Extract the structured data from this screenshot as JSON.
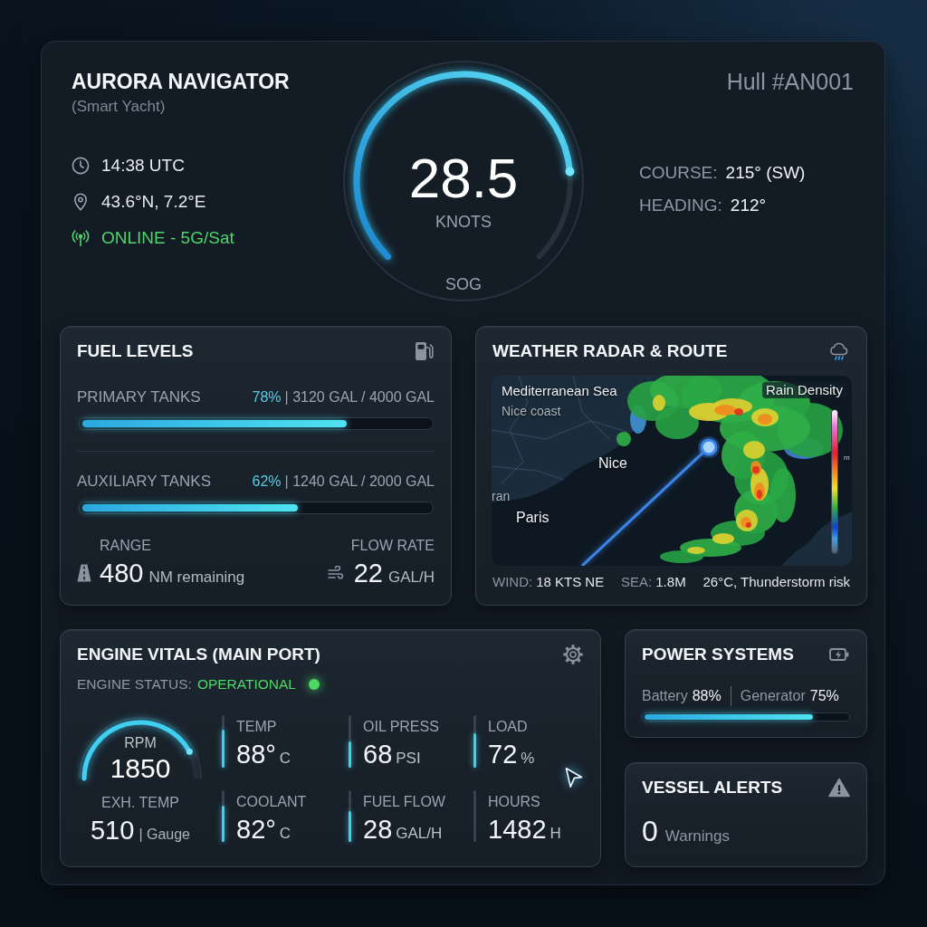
{
  "header": {
    "title": "AURORA NAVIGATOR",
    "subtitle": "(Smart Yacht)",
    "info": [
      {
        "kind": "time",
        "text": "14:38 UTC"
      },
      {
        "kind": "position",
        "text": "43.6°N, 7.2°E"
      },
      {
        "kind": "connection",
        "text": "ONLINE - 5G/Sat"
      }
    ],
    "speed_gauge": {
      "value": "28.5",
      "unit": "KNOTS",
      "caption": "SOG"
    },
    "hull": "Hull #AN001",
    "navigation": [
      {
        "label": "COURSE:",
        "value": "215° (SW)"
      },
      {
        "label": "HEADING:",
        "value": "212°"
      }
    ]
  },
  "fuel": {
    "title": "FUEL LEVELS",
    "tanks": [
      {
        "name": "PRIMARY TANKS",
        "percent": "78%",
        "detail": "| 3120 GAL / 4000 GAL",
        "level": 0.76
      },
      {
        "name": "AUXILIARY TANKS",
        "percent": "62%",
        "detail": "| 1240 GAL / 2000 GAL",
        "level": 0.62
      }
    ],
    "stats": [
      {
        "kind": "range",
        "label": "RANGE",
        "value": "480",
        "unit": "NM remaining"
      },
      {
        "kind": "flow",
        "label": "FLOW RATE",
        "value": "22",
        "unit": "GAL/H"
      }
    ]
  },
  "weather": {
    "title": "WEATHER RADAR & ROUTE",
    "map": {
      "region": "Mediterranean Sea",
      "area": "Nice coast",
      "places": [
        "Nice",
        "ran",
        "Paris"
      ],
      "legend_title": "Rain Density",
      "legend_unit": "m"
    },
    "conditions": [
      {
        "label": "WIND:",
        "value": "18 KTS NE"
      },
      {
        "label": "SEA:",
        "value": "1.8M"
      },
      {
        "value": "26°C, Thunderstorm risk"
      }
    ]
  },
  "engine": {
    "title": "ENGINE VITALS (MAIN PORT)",
    "status": {
      "label": "ENGINE STATUS:",
      "value": "OPERATIONAL",
      "ok": true
    },
    "rpm": {
      "label": "RPM",
      "value": "1850",
      "level": 0.84
    },
    "exhaust": {
      "label": "EXH. TEMP",
      "value": "510",
      "unit": "| Gauge"
    },
    "metrics": [
      {
        "label": "TEMP",
        "value": "88°",
        "unit": "C",
        "level": 0.72
      },
      {
        "label": "OIL PRESS",
        "value": "68",
        "unit": "PSI",
        "level": 0.5
      },
      {
        "label": "LOAD",
        "value": "72",
        "unit": "%",
        "level": 0.66
      },
      {
        "label": "COOLANT",
        "value": "82°",
        "unit": "C",
        "level": 0.7
      },
      {
        "label": "FUEL FLOW",
        "value": "28",
        "unit": "GAL/H",
        "level": 0.6
      },
      {
        "label": "HOURS",
        "value": "1482",
        "unit": "H"
      }
    ]
  },
  "power": {
    "title": "POWER SYSTEMS",
    "readings": [
      {
        "label": "Battery",
        "value": "88%"
      },
      {
        "label": "Generator",
        "value": "75%"
      }
    ],
    "level": 0.83
  },
  "alerts": {
    "title": "VESSEL ALERTS",
    "count": "0",
    "label": "Warnings"
  }
}
